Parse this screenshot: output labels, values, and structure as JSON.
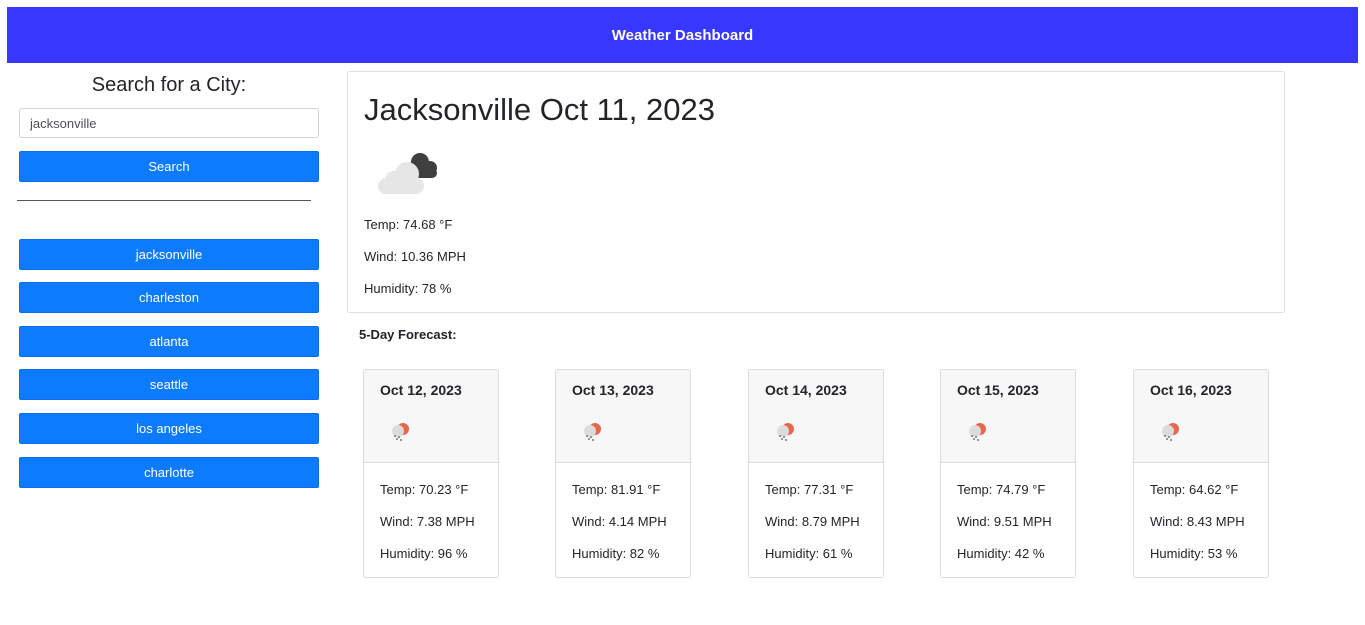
{
  "header": {
    "title": "Weather Dashboard"
  },
  "search": {
    "title": "Search for a City:",
    "value": "jacksonville",
    "button_label": "Search"
  },
  "history": [
    "jacksonville",
    "charleston",
    "atlanta",
    "seattle",
    "los angeles",
    "charlotte"
  ],
  "current": {
    "heading": "Jacksonville Oct 11, 2023",
    "icon": "broken-clouds-icon",
    "temp": "Temp: 74.68 °F",
    "wind": "Wind: 10.36 MPH",
    "humidity": "Humidity: 78 %"
  },
  "forecast": {
    "label": "5-Day Forecast:",
    "days": [
      {
        "date": "Oct 12, 2023",
        "icon": "light-rain-icon",
        "temp": "Temp: 70.23 °F",
        "wind": "Wind: 7.38 MPH",
        "humidity": "Humidity: 96 %"
      },
      {
        "date": "Oct 13, 2023",
        "icon": "light-rain-icon",
        "temp": "Temp: 81.91 °F",
        "wind": "Wind: 4.14 MPH",
        "humidity": "Humidity: 82 %"
      },
      {
        "date": "Oct 14, 2023",
        "icon": "light-rain-icon",
        "temp": "Temp: 77.31 °F",
        "wind": "Wind: 8.79 MPH",
        "humidity": "Humidity: 61 %"
      },
      {
        "date": "Oct 15, 2023",
        "icon": "light-rain-icon",
        "temp": "Temp: 74.79 °F",
        "wind": "Wind: 9.51 MPH",
        "humidity": "Humidity: 42 %"
      },
      {
        "date": "Oct 16, 2023",
        "icon": "light-rain-icon",
        "temp": "Temp: 64.62 °F",
        "wind": "Wind: 8.43 MPH",
        "humidity": "Humidity: 53 %"
      }
    ]
  },
  "colors": {
    "header": "#3737ff",
    "button": "#0d7bff",
    "card_head": "#f7f7f7"
  }
}
